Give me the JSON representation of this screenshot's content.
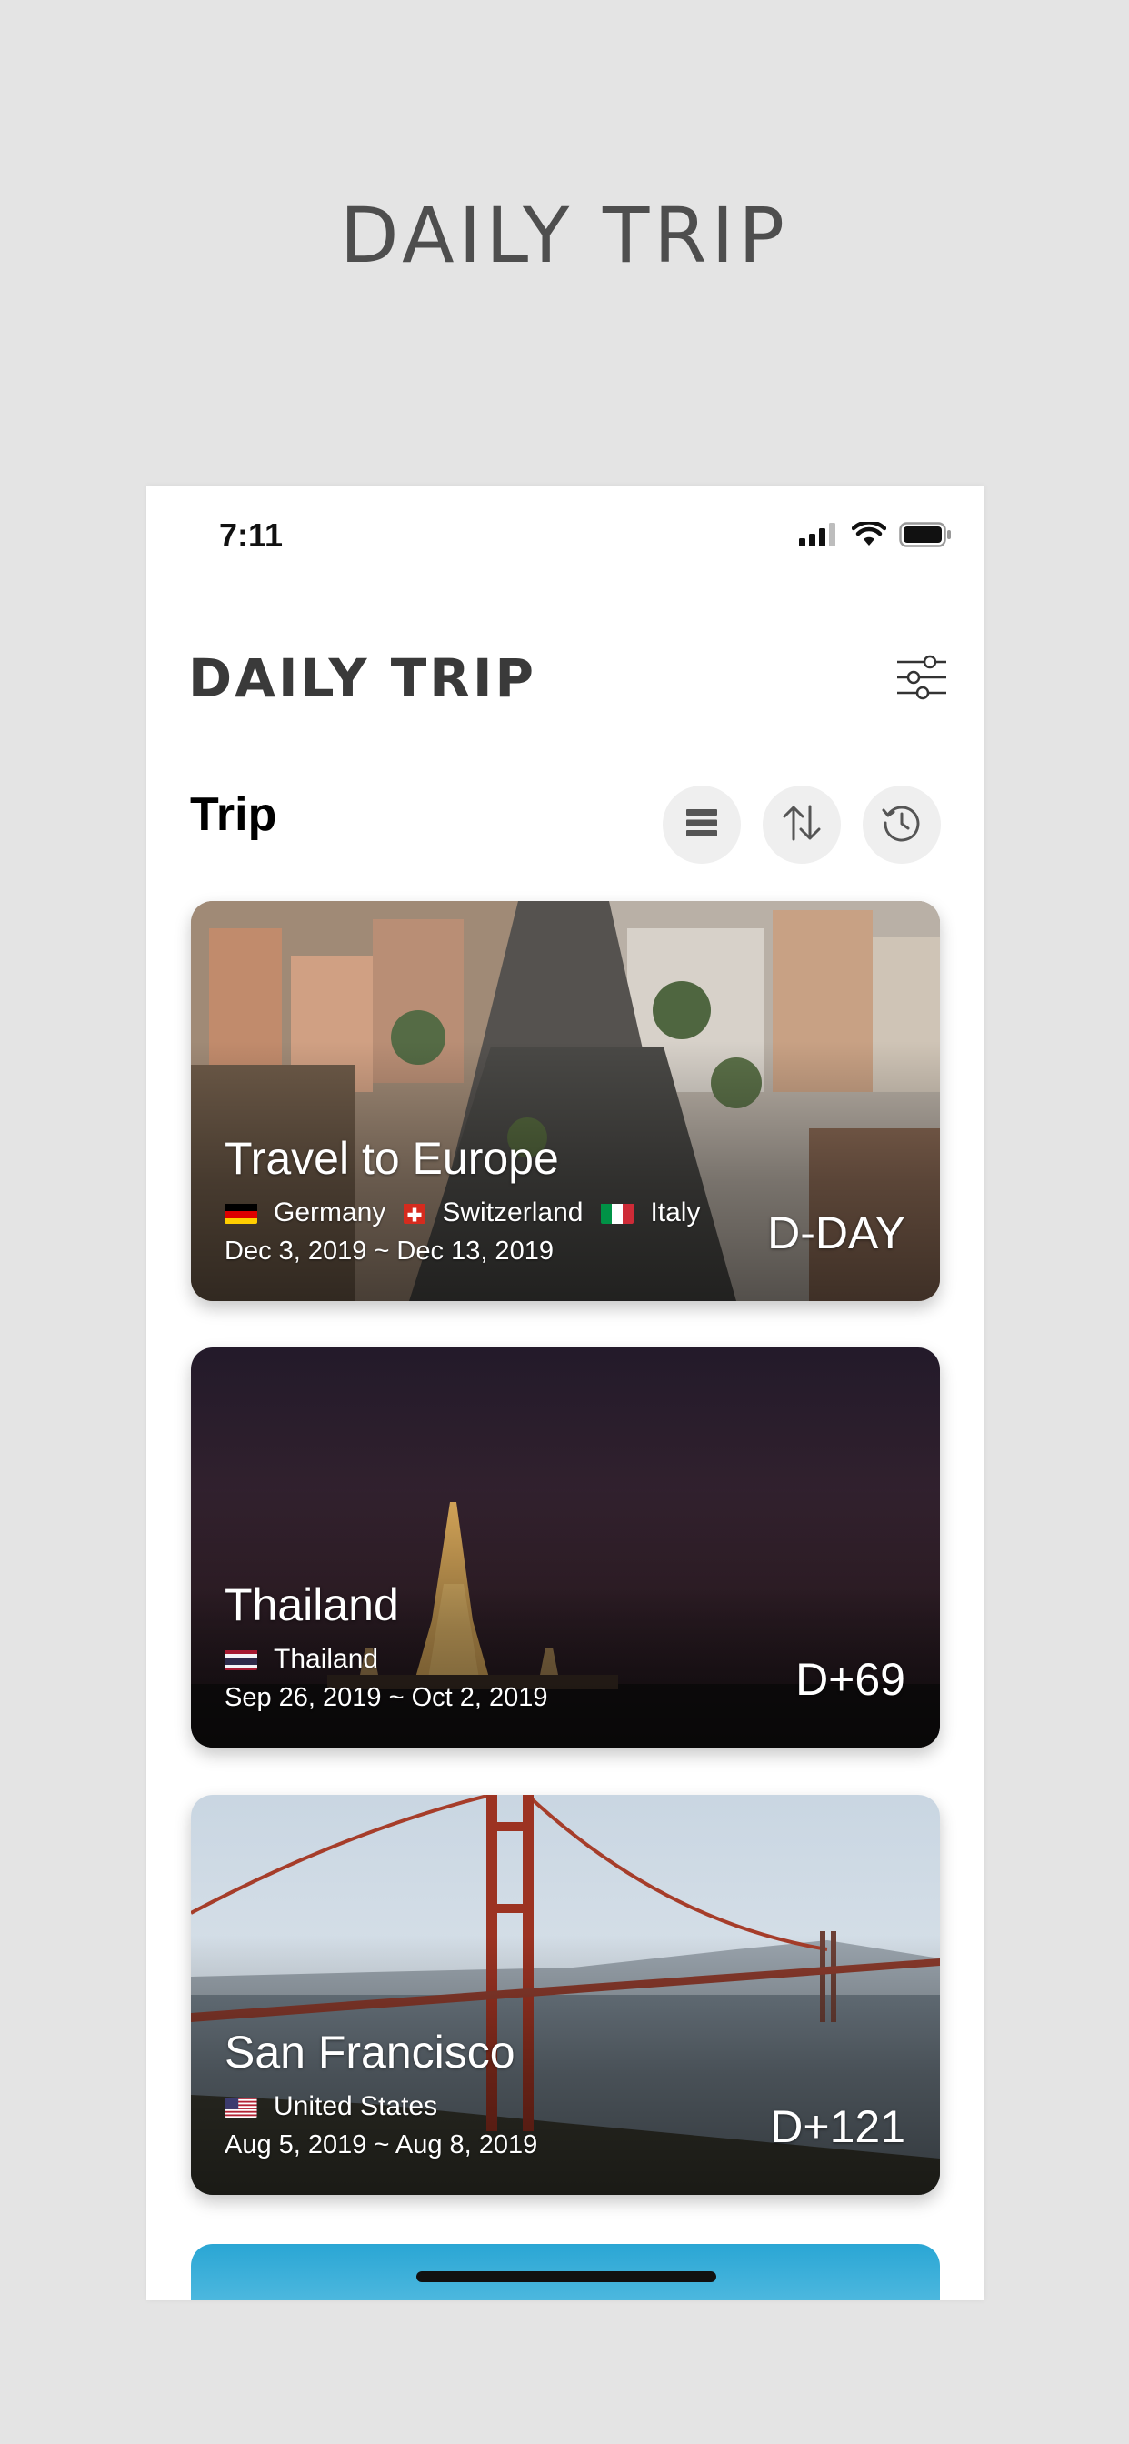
{
  "promo": {
    "title": "DAILY TRIP"
  },
  "status_bar": {
    "time": "7:11"
  },
  "header": {
    "app_title": "DAILY TRIP"
  },
  "section": {
    "title": "Trip"
  },
  "icons": {
    "settings": "sliders-icon",
    "list": "list-icon",
    "sort": "sort-arrows-icon",
    "history": "history-icon",
    "signal": "cellular-signal-icon",
    "wifi": "wifi-icon",
    "battery": "battery-icon"
  },
  "trips": [
    {
      "name": "Travel to Europe",
      "countries": [
        {
          "name": "Germany",
          "flag": "de"
        },
        {
          "name": "Switzerland",
          "flag": "ch"
        },
        {
          "name": "Italy",
          "flag": "it"
        }
      ],
      "dates": "Dec 3, 2019 ~ Dec 13, 2019",
      "dday": "D-DAY"
    },
    {
      "name": "Thailand",
      "countries": [
        {
          "name": "Thailand",
          "flag": "th"
        }
      ],
      "dates": "Sep 26, 2019 ~ Oct 2, 2019",
      "dday": "D+69"
    },
    {
      "name": "San Francisco",
      "countries": [
        {
          "name": "United States",
          "flag": "us"
        }
      ],
      "dates": "Aug 5, 2019 ~ Aug 8, 2019",
      "dday": "D+121"
    }
  ],
  "colors": {
    "background": "#e4e4e4",
    "screen": "#ffffff",
    "title": "#4e4e4e",
    "tool_button": "#efefef"
  }
}
